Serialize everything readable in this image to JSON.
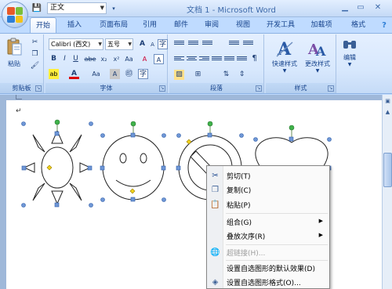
{
  "window": {
    "title": "文档 1 - Microsoft Word",
    "style_box_value": "正文",
    "controls": [
      "minimize",
      "maximize",
      "close"
    ]
  },
  "tabs": [
    {
      "label": "开始",
      "active": true
    },
    {
      "label": "插入"
    },
    {
      "label": "页面布局"
    },
    {
      "label": "引用"
    },
    {
      "label": "邮件"
    },
    {
      "label": "审阅"
    },
    {
      "label": "视图"
    },
    {
      "label": "开发工具"
    },
    {
      "label": "加载项"
    },
    {
      "label": "格式"
    }
  ],
  "ribbon": {
    "clipboard": {
      "label": "剪贴板",
      "paste_label": "粘贴"
    },
    "font": {
      "label": "字体",
      "font_name": "Calibri (西文)",
      "font_size": "五号",
      "bold": "B",
      "italic": "I",
      "underline": "U",
      "strike": "abe",
      "subscript": "x₂",
      "superscript": "x²",
      "aa": "Aa",
      "grow": "A",
      "shrink": "A",
      "clear": "A",
      "char_border": "A",
      "char_shading": "A",
      "phonetic": "wén",
      "enclose": "字"
    },
    "paragraph": {
      "label": "段落"
    },
    "styles": {
      "label": "样式",
      "quick_styles": "快速样式",
      "change_styles": "更改样式"
    },
    "editing": {
      "label": "编辑"
    }
  },
  "context_menu": {
    "items": [
      {
        "label": "剪切(T)",
        "icon": "scissors-icon",
        "disabled": false,
        "submenu": false
      },
      {
        "label": "复制(C)",
        "icon": "copy-icon",
        "disabled": false,
        "submenu": false
      },
      {
        "label": "粘贴(P)",
        "icon": "paste-icon",
        "disabled": false,
        "submenu": false
      },
      {
        "label": "组合(G)",
        "icon": "",
        "disabled": false,
        "submenu": true
      },
      {
        "label": "叠放次序(R)",
        "icon": "",
        "disabled": false,
        "submenu": true
      },
      {
        "label": "超链接(H)...",
        "icon": "hyperlink-icon",
        "disabled": true,
        "submenu": false
      },
      {
        "label": "设置自选图形的默认效果(D)",
        "icon": "",
        "disabled": false,
        "submenu": false
      },
      {
        "label": "设置自选图形格式(O)...",
        "icon": "format-shape-icon",
        "disabled": false,
        "submenu": false
      }
    ]
  },
  "colors": {
    "accent": "#15428b",
    "ribbon_bg": "#dbe8fb",
    "doc_bg": "#9fb8d9",
    "handle_blue": "#4a78c2",
    "handle_green": "#3fb24a"
  }
}
